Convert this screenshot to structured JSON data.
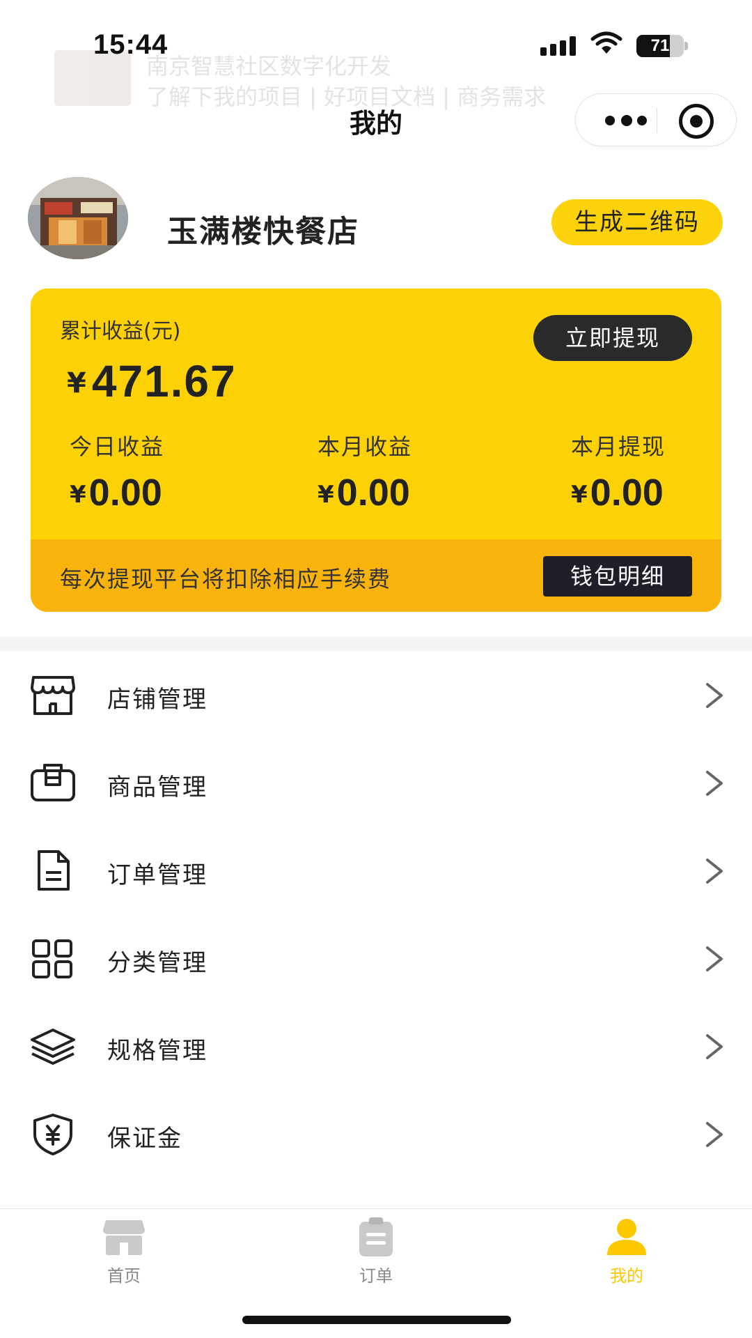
{
  "status_bar": {
    "time": "15:44",
    "battery": "71",
    "battery_level": 0.71,
    "background_text_line1": "南京智慧社区数字化开发",
    "background_text_line2": "了解下我的项目 | 好项目文档 | 商务需求"
  },
  "nav": {
    "title": "我的",
    "more_icon": "more-dots-icon",
    "close_icon": "target-circle-icon"
  },
  "profile": {
    "shop_name": "玉满楼快餐店",
    "qr_button": "生成二维码"
  },
  "earnings": {
    "cumulative_label": "累计收益(元)",
    "currency_symbol": "¥",
    "cumulative_value": "471.67",
    "withdraw_button": "立即提现",
    "stats": [
      {
        "label": "今日收益",
        "value": "0.00"
      },
      {
        "label": "本月收益",
        "value": "0.00"
      },
      {
        "label": "本月提现",
        "value": "0.00"
      }
    ],
    "footer_note": "每次提现平台将扣除相应手续费",
    "wallet_button": "钱包明细"
  },
  "menu": [
    {
      "label": "店铺管理",
      "icon": "store-icon"
    },
    {
      "label": "商品管理",
      "icon": "product-box-icon"
    },
    {
      "label": "订单管理",
      "icon": "document-icon"
    },
    {
      "label": "分类管理",
      "icon": "grid-category-icon"
    },
    {
      "label": "规格管理",
      "icon": "layers-icon"
    },
    {
      "label": "保证金",
      "icon": "yen-shield-icon"
    }
  ],
  "tabbar": [
    {
      "label": "首页",
      "icon": "home-store-icon",
      "active": false
    },
    {
      "label": "订单",
      "icon": "clipboard-icon",
      "active": false
    },
    {
      "label": "我的",
      "icon": "person-icon",
      "active": true
    }
  ],
  "colors": {
    "accent_yellow": "#fcd105",
    "footer_orange": "#f8b30d",
    "dark_button": "#2a2a2a",
    "active_tab": "#fcc800"
  }
}
